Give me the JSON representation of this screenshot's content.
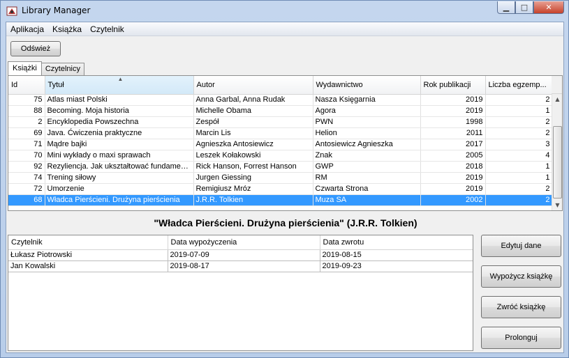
{
  "window": {
    "title": "Library Manager"
  },
  "menu": [
    "Aplikacja",
    "Książka",
    "Czytelnik"
  ],
  "toolbar": {
    "refresh_label": "Odśwież"
  },
  "tabs": [
    "Książki",
    "Czytelnicy"
  ],
  "books": {
    "columns": [
      "Id",
      "Tytuł",
      "Autor",
      "Wydawnictwo",
      "Rok publikacji",
      "Liczba egzemp..."
    ],
    "rows": [
      [
        "75",
        "Atlas miast Polski",
        "Anna Garbal, Anna Rudak",
        "Nasza Księgarnia",
        "2019",
        "2"
      ],
      [
        "88",
        "Becoming. Moja historia",
        "Michelle Obama",
        "Agora",
        "2019",
        "1"
      ],
      [
        "2",
        "Encyklopedia Powszechna",
        "Zespół",
        "PWN",
        "1998",
        "2"
      ],
      [
        "69",
        "Java. Ćwiczenia praktyczne",
        "Marcin Lis",
        "Helion",
        "2011",
        "2"
      ],
      [
        "71",
        "Mądre bajki",
        "Agnieszka Antosiewicz",
        "Antosiewicz Agnieszka",
        "2017",
        "3"
      ],
      [
        "70",
        "Mini wykłady o maxi sprawach",
        "Leszek Kołakowski",
        "Znak",
        "2005",
        "4"
      ],
      [
        "92",
        "Rezyliencja. Jak ukształtować fundament...",
        "Rick Hanson, Forrest Hanson",
        "GWP",
        "2018",
        "1"
      ],
      [
        "74",
        "Trening siłowy",
        "Jurgen Giessing",
        "RM",
        "2019",
        "1"
      ],
      [
        "72",
        "Umorzenie",
        "Remigiusz Mróz",
        "Czwarta Strona",
        "2019",
        "2"
      ],
      [
        "68",
        "Władca Pierścieni. Drużyna pierścienia",
        "J.R.R. Tolkien",
        "Muza SA",
        "2002",
        "2"
      ]
    ],
    "selected_index": 9
  },
  "detail": {
    "heading": "\"Władca Pierścieni. Drużyna pierścienia\" (J.R.R. Tolkien)"
  },
  "loans": {
    "columns": [
      "Czytelnik",
      "Data wypożyczenia",
      "Data zwrotu"
    ],
    "rows": [
      [
        "Łukasz Piotrowski",
        "2019-07-09",
        "2019-08-15"
      ],
      [
        "Jan Kowalski",
        "2019-08-17",
        "2019-09-23"
      ]
    ]
  },
  "actions": {
    "edit_label": "Edytuj dane",
    "lend_label": "Wypożycz książkę",
    "return_label": "Zwróć książkę",
    "extend_label": "Prolonguj"
  },
  "icons": {
    "app": "app-icon",
    "minimize": "minimize-icon",
    "maximize": "maximize-icon",
    "close": "close-icon",
    "sort": "sort-ascending-icon"
  },
  "colors": {
    "selection": "#3399ff",
    "close_button": "#c6422b"
  }
}
